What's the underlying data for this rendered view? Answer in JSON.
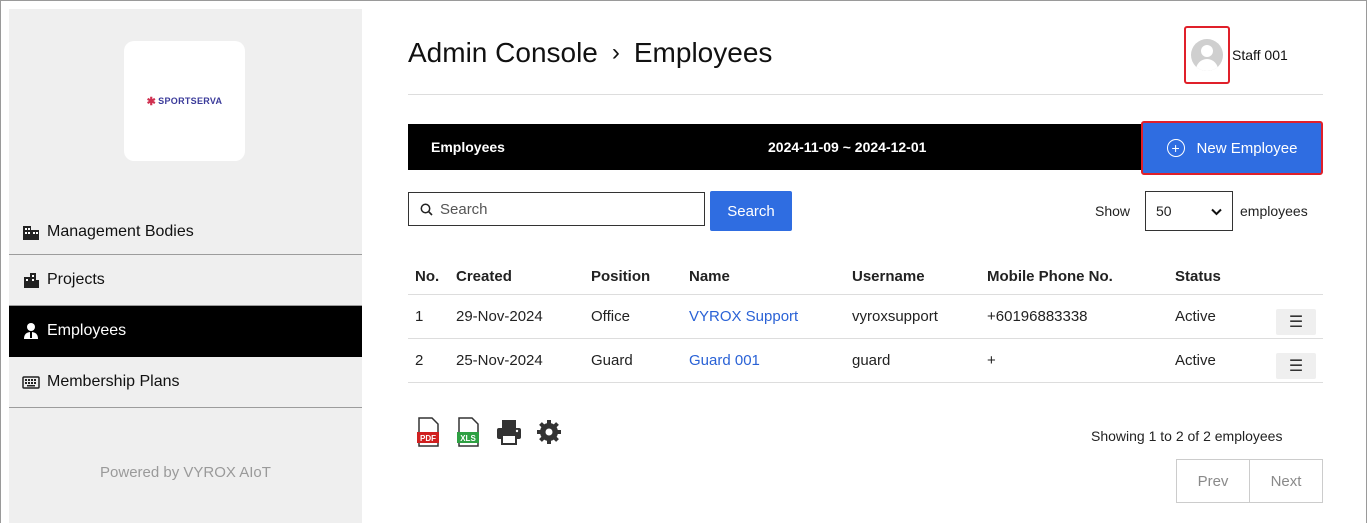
{
  "brand": {
    "logo_text": "SPORTSERVA",
    "powered_by": "Powered by VYROX AIoT"
  },
  "sidebar": {
    "items": [
      {
        "label": "Management Bodies",
        "icon": "building-icon"
      },
      {
        "label": "Projects",
        "icon": "city-icon"
      },
      {
        "label": "Employees",
        "icon": "employee-icon",
        "active": true
      },
      {
        "label": "Membership Plans",
        "icon": "keyboard-icon"
      }
    ]
  },
  "header": {
    "root": "Admin Console",
    "separator": "›",
    "current": "Employees",
    "user_name": "Staff 001"
  },
  "toolbar": {
    "title": "Employees",
    "date_range": "2024-11-09 ~ 2024-12-01",
    "new_button": "New Employee"
  },
  "search": {
    "placeholder": "Search",
    "button_label": "Search"
  },
  "show": {
    "label": "Show",
    "value": "50",
    "suffix": "employees"
  },
  "table": {
    "columns": [
      "No.",
      "Created",
      "Position",
      "Name",
      "Username",
      "Mobile Phone No.",
      "Status"
    ],
    "rows": [
      {
        "no": "1",
        "created": "29-Nov-2024",
        "position": "Office",
        "name": "VYROX Support",
        "username": "vyroxsupport",
        "phone": "+60196883338",
        "status": "Active"
      },
      {
        "no": "2",
        "created": "25-Nov-2024",
        "position": "Guard",
        "name": "Guard 001",
        "username": "guard",
        "phone": "+",
        "status": "Active"
      }
    ]
  },
  "footer": {
    "showing_text": "Showing 1 to 2 of 2 employees",
    "prev": "Prev",
    "next": "Next",
    "export_icons": [
      "pdf-icon",
      "xls-icon",
      "print-icon",
      "settings-icon"
    ]
  },
  "colors": {
    "accent": "#2f6de1",
    "highlight": "#e0202a",
    "bar": "#000000",
    "link": "#2a62d6"
  }
}
